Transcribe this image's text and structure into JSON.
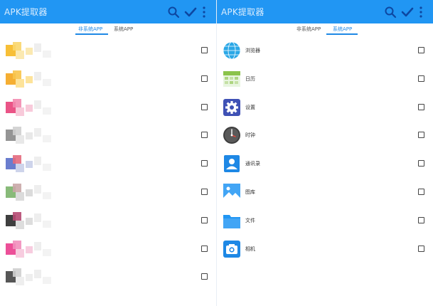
{
  "left_panel": {
    "title": "APK提取器",
    "tabs": [
      {
        "label": "非系统APP",
        "active": true
      },
      {
        "label": "系统APP",
        "active": false
      }
    ],
    "apps": [
      {
        "label": "",
        "icon": "blurred-app-icon"
      },
      {
        "label": "",
        "icon": "blurred-app-icon"
      },
      {
        "label": "",
        "icon": "blurred-app-icon"
      },
      {
        "label": "",
        "icon": "blurred-app-icon"
      },
      {
        "label": "",
        "icon": "blurred-app-icon"
      },
      {
        "label": "",
        "icon": "blurred-app-icon"
      },
      {
        "label": "",
        "icon": "blurred-app-icon"
      },
      {
        "label": "",
        "icon": "blurred-app-icon"
      },
      {
        "label": "",
        "icon": "blurred-app-icon"
      }
    ]
  },
  "right_panel": {
    "title": "APK提取器",
    "tabs": [
      {
        "label": "非系统APP",
        "active": false
      },
      {
        "label": "系统APP",
        "active": true
      }
    ],
    "apps": [
      {
        "label": "浏览器",
        "icon": "browser-globe-icon"
      },
      {
        "label": "日历",
        "icon": "calendar-icon"
      },
      {
        "label": "设置",
        "icon": "settings-gear-icon"
      },
      {
        "label": "时钟",
        "icon": "clock-icon"
      },
      {
        "label": "通讯录",
        "icon": "contacts-icon"
      },
      {
        "label": "图库",
        "icon": "gallery-icon"
      },
      {
        "label": "文件",
        "icon": "folder-icon"
      },
      {
        "label": "相机",
        "icon": "camera-icon"
      }
    ]
  },
  "colors": {
    "appbar": "#2196f3",
    "accent": "#1e88e5",
    "checkbox_border": "#444444"
  },
  "toolbar_icons": [
    "search-icon",
    "check-icon",
    "more-vert-icon"
  ]
}
